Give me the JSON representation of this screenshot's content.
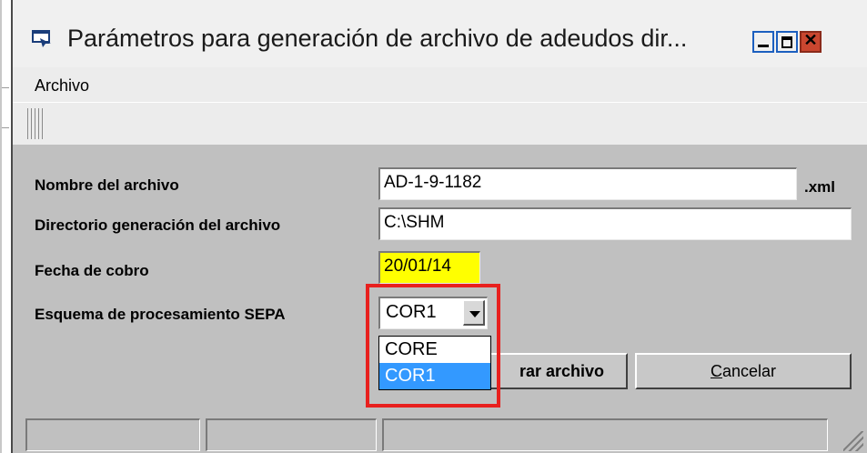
{
  "window": {
    "title": "Parámetros para generación de archivo de adeudos dir...",
    "close_glyph": "✕"
  },
  "menu": {
    "items": [
      "Archivo"
    ]
  },
  "form": {
    "nombre_label": "Nombre del archivo",
    "nombre_value": "AD-1-9-1182",
    "nombre_ext": ".xml",
    "directorio_label": "Directorio generación del archivo",
    "directorio_value": "C:\\SHM",
    "fecha_label": "Fecha de cobro",
    "fecha_value": "20/01/14",
    "esquema_label": "Esquema de procesamiento SEPA",
    "esquema_value": "COR1",
    "esquema_options": [
      "CORE",
      "COR1"
    ],
    "esquema_selected_option": "COR1"
  },
  "buttons": {
    "generar_visible": "rar archivo",
    "cancelar_accel": "C",
    "cancelar_rest": "ancelar"
  },
  "colors": {
    "highlight": "#e8201e",
    "date_bg": "#ffff00",
    "selection": "#3399ff"
  },
  "icons": {
    "window_icon": "window-app-icon",
    "toolbar_grip": "toolbar-grip-icon",
    "size_grip": "resize-grip-icon"
  }
}
